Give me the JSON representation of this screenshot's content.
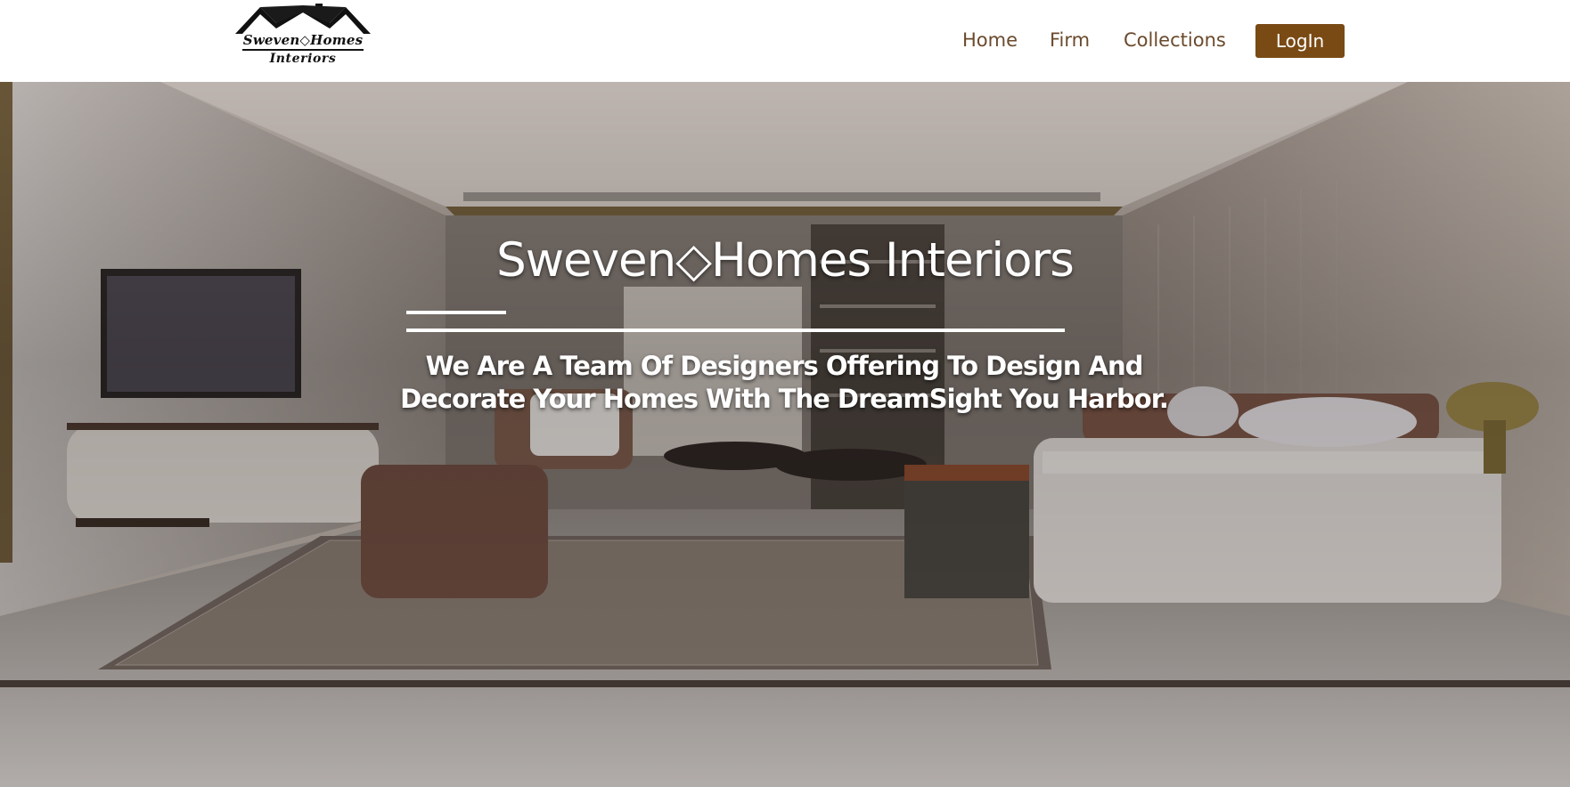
{
  "header": {
    "logo": {
      "line1": "Sweven◇Homes",
      "line2": "Interiors",
      "icon": "house-roof-icon"
    },
    "nav": [
      {
        "label": "Home"
      },
      {
        "label": "Firm"
      },
      {
        "label": "Collections"
      }
    ],
    "login_label": "LogIn"
  },
  "hero": {
    "title": "Sweven◇Homes Interiors",
    "subtitle": "We Are A Team Of Designers Offering To Design And Decorate Your Homes With The DreamSight You Harbor.",
    "background": "living-room-interior-photo"
  },
  "colors": {
    "nav_text": "#6b4a2c",
    "login_bg": "#7a4a14",
    "hero_text": "#ffffff"
  }
}
